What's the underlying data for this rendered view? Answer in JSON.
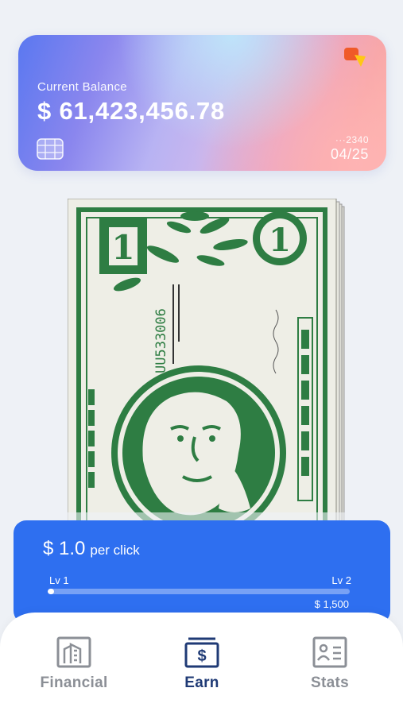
{
  "card": {
    "label": "Current Balance",
    "balance": "$ 61,423,456.78",
    "number": "···2340",
    "expiry": "04/25",
    "brand_icon": "card-brand-icon",
    "chip_icon": "chip-icon"
  },
  "bill": {
    "serial": "UU533006",
    "denomination": "1",
    "icon": "dollar-bill-stack"
  },
  "upgrade": {
    "rate_value": "$ 1.0",
    "rate_unit": "per click",
    "level_current": "Lv 1",
    "level_next": "Lv 2",
    "progress_fraction": 0.02,
    "cost": "$ 1,500"
  },
  "nav": {
    "items": [
      {
        "label": "Financial",
        "icon": "building-icon",
        "active": false
      },
      {
        "label": "Earn",
        "icon": "dollar-wallet-icon",
        "active": true
      },
      {
        "label": "Stats",
        "icon": "id-card-icon",
        "active": false
      }
    ]
  },
  "colors": {
    "accent": "#2e6ff0",
    "nav_active": "#1f3a75",
    "nav_inactive": "#8b8f96",
    "bill_green": "#2e7d43",
    "background": "#eef1f6"
  }
}
